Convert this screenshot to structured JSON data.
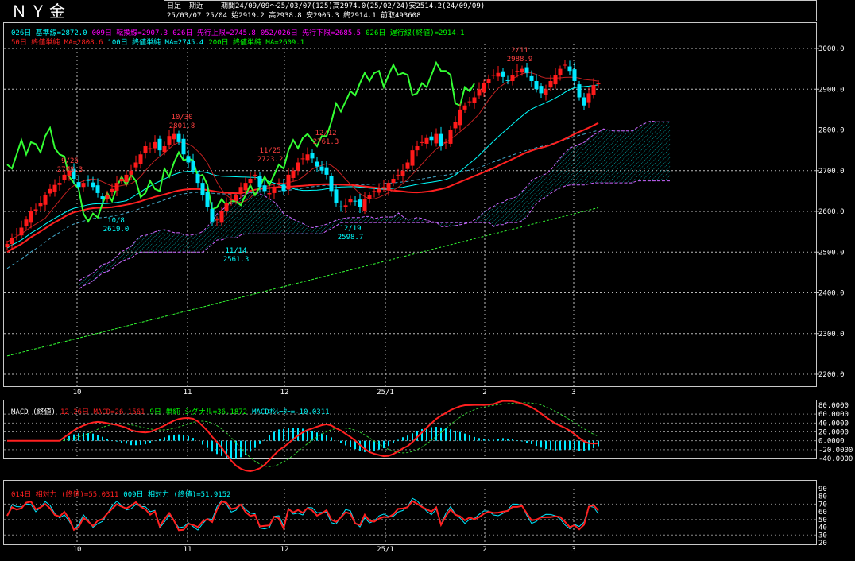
{
  "header": {
    "title": "ＮＹ金",
    "mode": "日足",
    "period_label": "期近",
    "range_info": "期間24/09/09～25/03/07(125)高2974.0(25/02/24)安2514.2(24/09/09)",
    "last_bar_info": "25/03/07 25/04 始2919.2 高2938.8 安2905.3 終2914.1 前取493608"
  },
  "legend_main_1": [
    {
      "text": "026日 基準線=2872.0",
      "color": "#00ffff"
    },
    {
      "text": "009日 転換線=2907.3",
      "color": "#ff00ff"
    },
    {
      "text": "026日 先行上限=2745.8",
      "color": "#ff00ff"
    },
    {
      "text": "052/026日 先行下限=2685.5",
      "color": "#ff00ff"
    },
    {
      "text": "026日 遅行線(終値)=2914.1",
      "color": "#00ff00"
    }
  ],
  "legend_main_2": [
    {
      "text": "50日 終値単純 MA=2808.6",
      "color": "#ff2020"
    },
    {
      "text": "100日 終値単純 MA=2745.4",
      "color": "#00ffff"
    },
    {
      "text": "200日 終値単純 MA=2609.1",
      "color": "#00ff00"
    }
  ],
  "legend_macd": [
    {
      "text": "MACD (終値)",
      "color": "#ffffff"
    },
    {
      "text": "12-26日 MACD=26.1561",
      "color": "#ff2020"
    },
    {
      "text": "9日 単純 シグナル=36.1872",
      "color": "#00ff00"
    },
    {
      "text": "MACDｵｼﾚｰﾀｰ=-10.0311",
      "color": "#00ffff"
    }
  ],
  "legend_rsi": [
    {
      "text": "014日 相対力 (終値)=55.0311",
      "color": "#ff2020"
    },
    {
      "text": "009日 相対力 (終値)=51.9152",
      "color": "#00ffff"
    }
  ],
  "x_ticks": [
    "10",
    "11",
    "12",
    "25/1",
    "2",
    "3"
  ],
  "colors": {
    "up": "#ff1a1a",
    "down": "#00e8ff",
    "kijun": "#00ffff",
    "tenkan": "#ff2020",
    "chikou": "#33ff33",
    "ma50": "#ff2020",
    "ma100": "#00ffff",
    "ma200": "#33ff33",
    "cloud_line": "#cc66ff",
    "cloud_fill": "#00e0e0",
    "annot_hi": "#ff4040",
    "annot_lo": "#00ffff"
  },
  "chart_data": [
    {
      "type": "candlestick",
      "panel": "price",
      "y_ticks": [
        "3000.0",
        "2900.0",
        "2800.0",
        "2700.0",
        "2600.0",
        "2500.0",
        "2400.0",
        "2300.0",
        "2200.0"
      ],
      "ylim": [
        2200,
        3000
      ],
      "x_dates": [
        "24/10",
        "24/11",
        "24/12",
        "25/1",
        "25/2",
        "25/3"
      ],
      "annotations": [
        {
          "date": "9/26",
          "value": "2708.3",
          "kind": "high"
        },
        {
          "date": "10/8",
          "value": "2619.0",
          "kind": "low"
        },
        {
          "date": "10/30",
          "value": "2801.8",
          "kind": "high"
        },
        {
          "date": "11/14",
          "value": "2561.3",
          "kind": "low"
        },
        {
          "date": "11/25",
          "value": "2723.2",
          "kind": "high"
        },
        {
          "date": "12/12",
          "value": "2761.3",
          "kind": "high"
        },
        {
          "date": "12/19",
          "value": "2598.7",
          "kind": "low"
        },
        {
          "date": "2/11",
          "value": "2988.9",
          "kind": "high"
        }
      ],
      "ohlc_start": "24/09/09",
      "close_series": [
        2520,
        2535,
        2545,
        2560,
        2580,
        2600,
        2605,
        2620,
        2640,
        2655,
        2665,
        2670,
        2690,
        2700,
        2680,
        2660,
        2670,
        2675,
        2660,
        2645,
        2630,
        2640,
        2655,
        2670,
        2680,
        2690,
        2700,
        2720,
        2740,
        2760,
        2755,
        2770,
        2750,
        2760,
        2785,
        2790,
        2770,
        2740,
        2720,
        2700,
        2670,
        2640,
        2610,
        2575,
        2580,
        2600,
        2620,
        2630,
        2640,
        2660,
        2670,
        2680,
        2690,
        2660,
        2650,
        2645,
        2660,
        2670,
        2650,
        2690,
        2700,
        2720,
        2730,
        2740,
        2730,
        2710,
        2700,
        2690,
        2650,
        2620,
        2610,
        2615,
        2630,
        2625,
        2610,
        2630,
        2640,
        2650,
        2655,
        2660,
        2670,
        2680,
        2690,
        2700,
        2720,
        2750,
        2760,
        2770,
        2780,
        2775,
        2790,
        2760,
        2770,
        2800,
        2820,
        2850,
        2860,
        2870,
        2880,
        2900,
        2915,
        2925,
        2935,
        2940,
        2930,
        2920,
        2935,
        2945,
        2950,
        2940,
        2920,
        2900,
        2890,
        2900,
        2920,
        2935,
        2950,
        2960,
        2945,
        2920,
        2880,
        2860,
        2890,
        2910,
        2914
      ]
    },
    {
      "type": "line",
      "panel": "macd",
      "y_ticks": [
        "80.0000",
        "60.0000",
        "40.0000",
        "20.0000",
        "0.0000",
        "-20.0000",
        "-40.0000"
      ],
      "ylim": [
        -40,
        80
      ],
      "series": [
        {
          "name": "12-26日 MACD",
          "last": 26.1561
        },
        {
          "name": "9日 単純 シグナル",
          "last": 36.1872
        },
        {
          "name": "MACDｵｼﾚｰﾀｰ",
          "last": -10.0311
        }
      ]
    },
    {
      "type": "line",
      "panel": "rsi",
      "y_ticks": [
        "90",
        "80",
        "70",
        "60",
        "50",
        "40",
        "30",
        "20"
      ],
      "ylim": [
        20,
        90
      ],
      "series": [
        {
          "name": "014日 相対力 (終値)",
          "last": 55.0311
        },
        {
          "name": "009日 相対力 (終値)",
          "last": 51.9152
        }
      ]
    }
  ]
}
